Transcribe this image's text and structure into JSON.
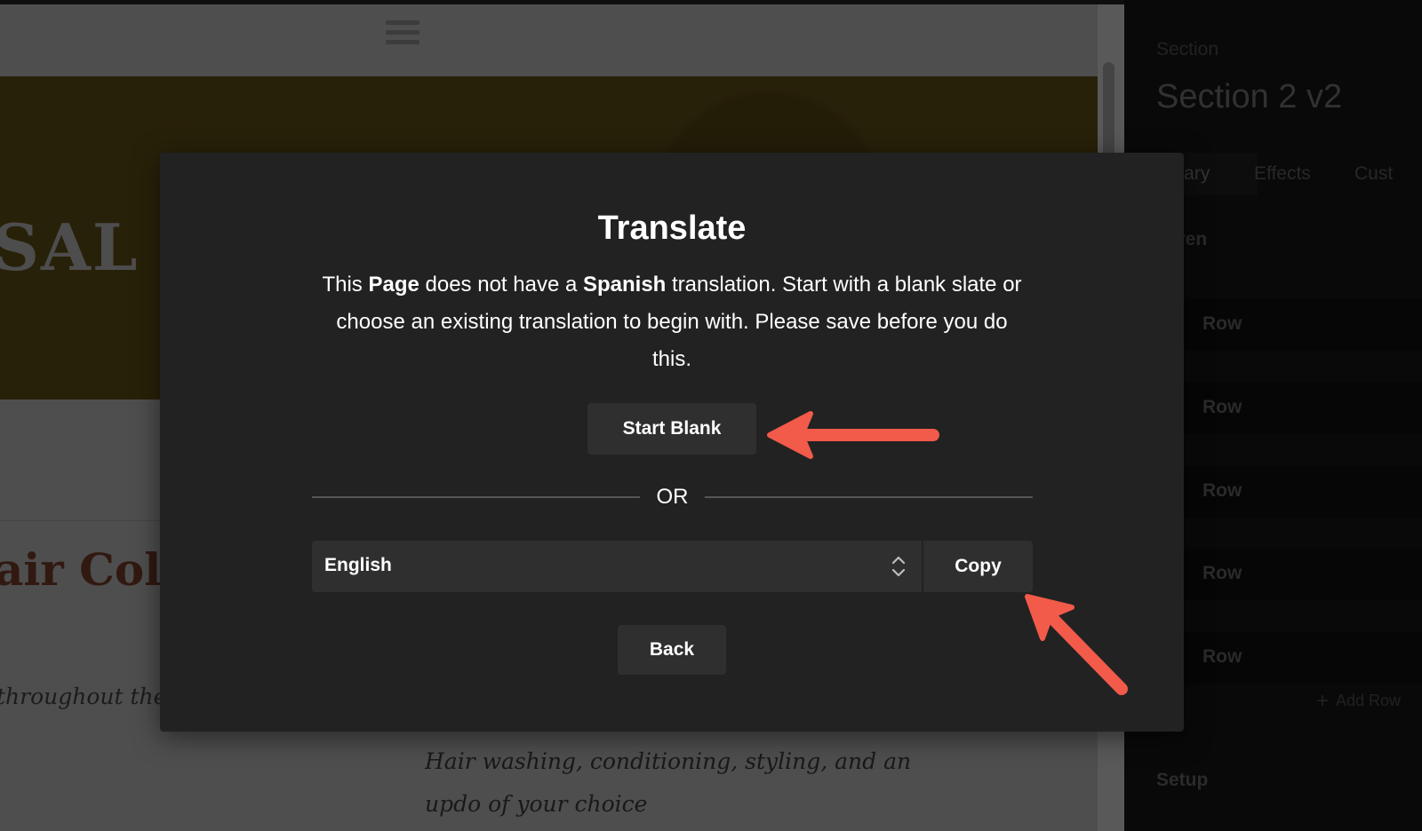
{
  "background_page": {
    "hero_text": "SAL",
    "section_title": "air Colo",
    "italic_left": "throughout the",
    "italic_desc": "Hair washing, conditioning, styling, and an updo of your choice"
  },
  "inspector": {
    "eyebrow": "Section",
    "title": "Section 2 v2",
    "tabs": [
      {
        "label": "rimary"
      },
      {
        "label": "Effects"
      },
      {
        "label": "Cust"
      }
    ],
    "children_label": "ildren",
    "rows": [
      {
        "label": "Row"
      },
      {
        "label": "Row"
      },
      {
        "label": "Row"
      },
      {
        "label": "Row"
      },
      {
        "label": "Row"
      }
    ],
    "add_row_label": "Add Row",
    "setup_label": "Setup"
  },
  "modal": {
    "title": "Translate",
    "body_1": "This ",
    "body_bold_1": "Page",
    "body_2": " does not have a ",
    "body_bold_2": "Spanish",
    "body_3": " translation. Start with a blank slate or choose an existing translation to begin with. Please save before you do this.",
    "start_blank_label": "Start Blank",
    "or_label": "OR",
    "language_select": {
      "selected": "English"
    },
    "copy_label": "Copy",
    "back_label": "Back"
  },
  "colors": {
    "arrow": "#f25a4a",
    "modal_bg": "#222222",
    "button_bg": "#2f2f2f"
  }
}
